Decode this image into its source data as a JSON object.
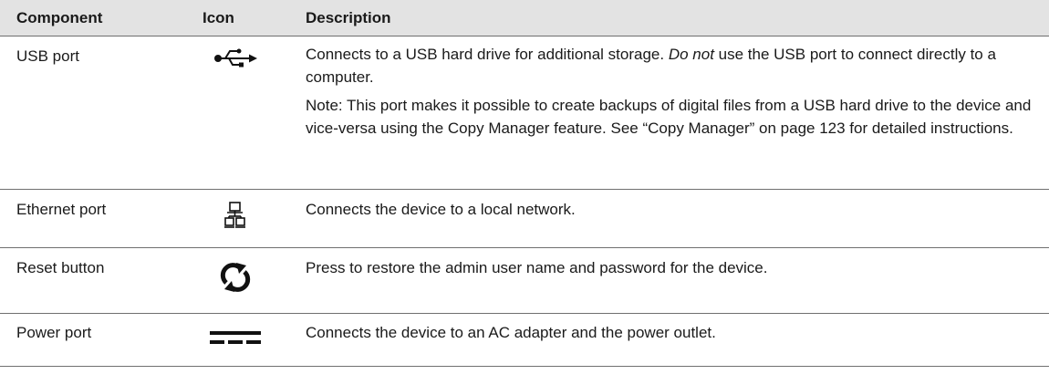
{
  "header": {
    "component": "Component",
    "icon": "Icon",
    "description": "Description"
  },
  "rows": [
    {
      "component": "USB port",
      "icon": "usb-icon",
      "description_part1": "Connects to a USB hard drive for additional storage. ",
      "description_emphasis": "Do not",
      "description_part2": " use the USB port to connect directly to a computer.",
      "note": "Note: This port makes it possible to create backups of digital files from a USB hard drive to the device and vice-versa using the Copy Manager feature. See “Copy Manager” on page 123 for detailed instructions."
    },
    {
      "component": "Ethernet port",
      "icon": "network-icon",
      "description": "Connects the device to a local network."
    },
    {
      "component": "Reset button",
      "icon": "reset-icon",
      "description": "Press to restore the admin user name and password for the device."
    },
    {
      "component": "Power port",
      "icon": "dc-power-icon",
      "description": "Connects the device to an AC adapter and the power outlet."
    }
  ]
}
